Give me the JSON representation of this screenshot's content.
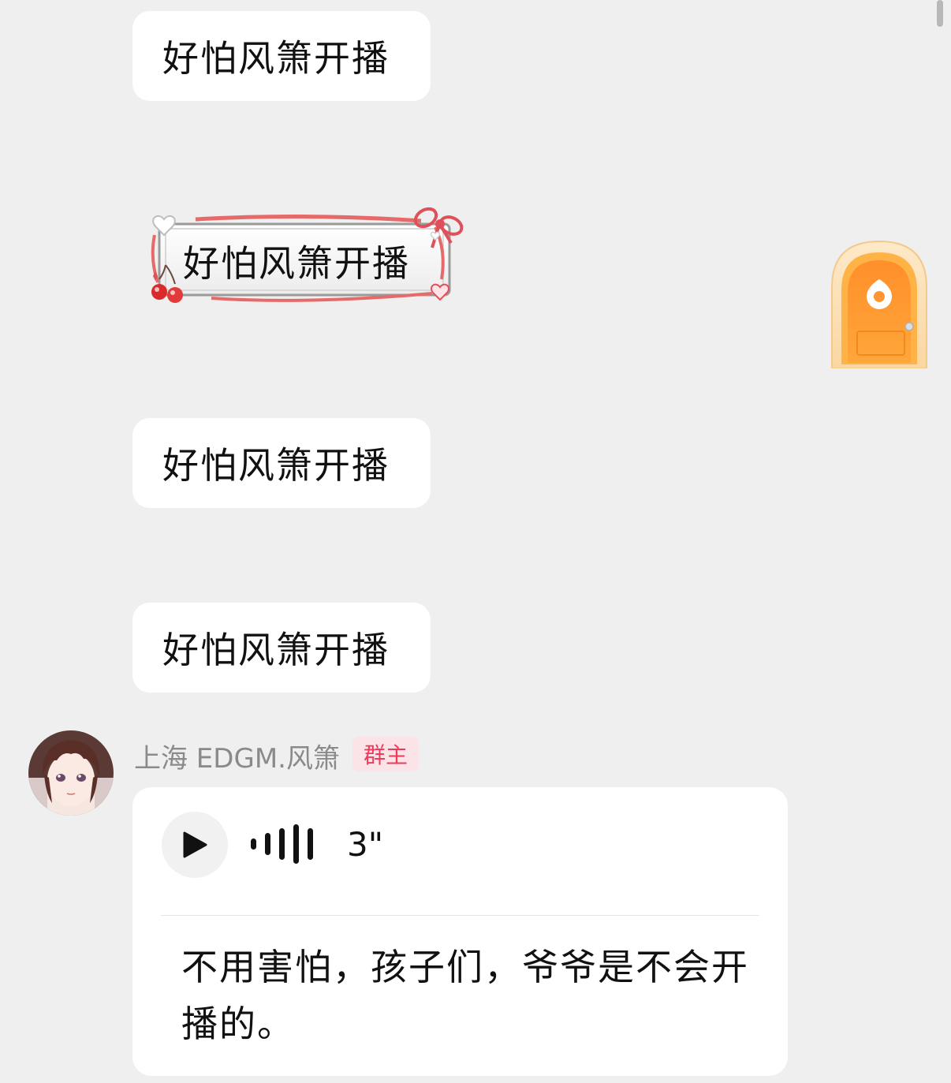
{
  "messages": [
    {
      "text": "好怕风箫开播"
    },
    {
      "text": "好怕风箫开播",
      "style": "ribbon-frame"
    },
    {
      "text": "好怕风箫开播"
    },
    {
      "text": "好怕风箫开播"
    }
  ],
  "sender": {
    "name": "上海 EDGM.风箫",
    "role": "群主",
    "role_color": "#ef3b5b"
  },
  "voice_message": {
    "duration": "3\"",
    "transcript": "不用害怕，孩子们，爷爷是不会开播的。"
  },
  "icons": {
    "play": "play-icon",
    "waveform": "waveform-icon",
    "door": "door-entry-icon"
  }
}
